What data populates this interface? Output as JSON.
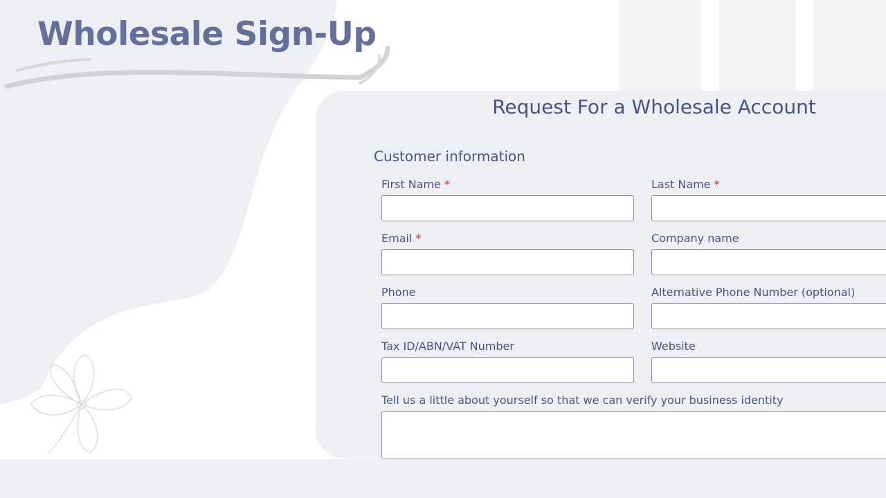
{
  "page": {
    "title": "Wholesale Sign-Up",
    "colors": {
      "title": "#65709a",
      "text": "#4a5280",
      "required": "#e0242f",
      "card_bg": "#eeeff4"
    }
  },
  "decor": {
    "swoosh": "brush-stroke-swoosh",
    "flower": "flower-line-art-icon"
  },
  "form": {
    "heading": "Request For a Wholesale Account",
    "section_title": "Customer information",
    "required_mark": "*",
    "fields": {
      "first_name": {
        "label": "First Name",
        "value": "",
        "required": true
      },
      "last_name": {
        "label": "Last Name",
        "value": "",
        "required": true
      },
      "email": {
        "label": "Email",
        "value": "",
        "required": true
      },
      "company_name": {
        "label": "Company name",
        "value": ""
      },
      "phone": {
        "label": "Phone",
        "value": ""
      },
      "alt_phone": {
        "label": "Alternative Phone Number (optional)",
        "value": ""
      },
      "tax_id": {
        "label": "Tax ID/ABN/VAT Number",
        "value": ""
      },
      "website": {
        "label": "Website",
        "value": ""
      },
      "about": {
        "label": "Tell us a little about yourself so that we can verify your business identity",
        "value": ""
      }
    }
  }
}
